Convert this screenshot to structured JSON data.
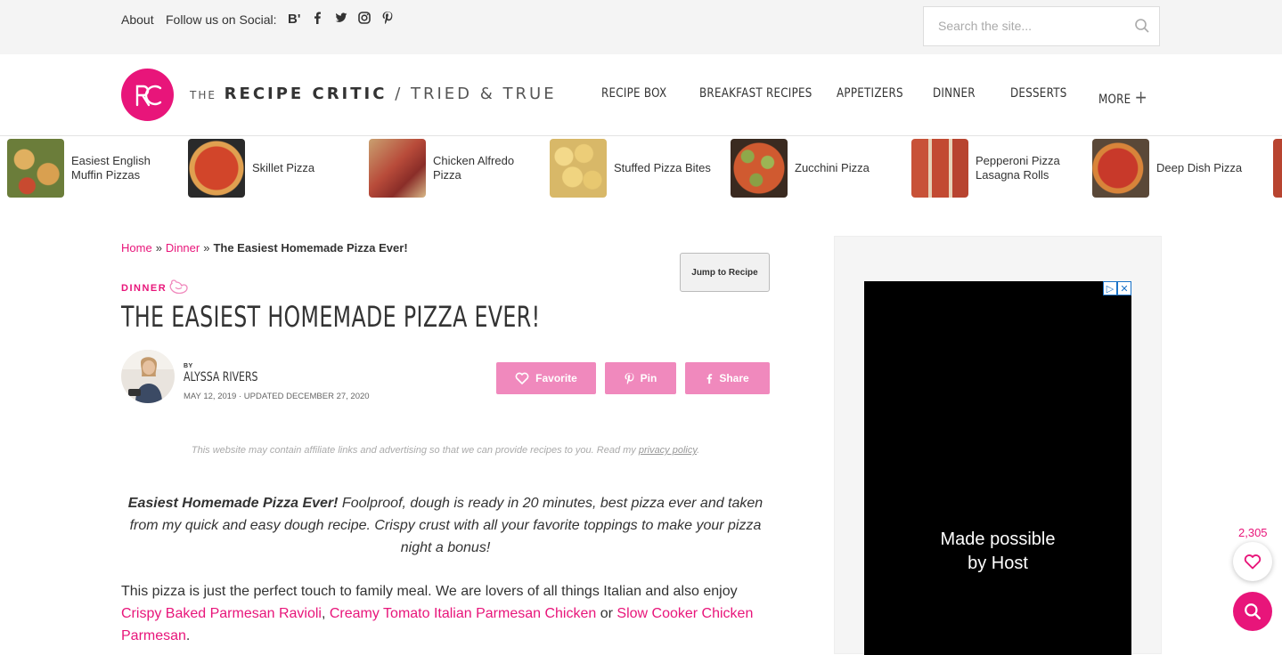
{
  "topbar": {
    "about": "About",
    "follow": "Follow us on Social:",
    "social_icons": [
      "bloglovin-icon",
      "facebook-icon",
      "twitter-icon",
      "instagram-icon",
      "pinterest-icon"
    ],
    "bloglovin_glyph": "B'",
    "search_placeholder": "Search the site..."
  },
  "header": {
    "logo_the": "THE",
    "logo_name": "RECIPE CRITIC",
    "logo_divider": "/",
    "logo_tagline": "TRIED & TRUE",
    "nav": [
      "RECIPE BOX",
      "BREAKFAST RECIPES",
      "APPETIZERS",
      "DINNER",
      "DESSERTS",
      "MORE"
    ],
    "more_glyph": "+"
  },
  "carousel": [
    "Easiest English Muffin Pizzas",
    "Skillet Pizza",
    "Chicken Alfredo Pizza",
    "Stuffed Pizza Bites",
    "Zucchini Pizza",
    "Pepperoni Pizza Lasagna Rolls",
    "Deep Dish Pizza"
  ],
  "breadcrumb": {
    "home": "Home",
    "dinner": "Dinner",
    "sep": "»",
    "current": "The Easiest Homemade Pizza Ever!"
  },
  "jump_label": "Jump to Recipe",
  "category": "DINNER",
  "title": "THE EASIEST HOMEMADE PIZZA EVER!",
  "author": {
    "by": "BY",
    "name": "ALYSSA RIVERS",
    "dates": "MAY 12, 2019 · UPDATED DECEMBER 27, 2020"
  },
  "actions": {
    "favorite": "Favorite",
    "pin": "Pin",
    "share": "Share"
  },
  "disclaimer": {
    "text": "This website may contain affiliate links and advertising so that we can provide recipes to you. Read my ",
    "link": "privacy policy",
    "end": "."
  },
  "intro": {
    "bold": "Easiest Homemade Pizza Ever!",
    "rest": " Foolproof, dough is ready in 20 minutes, best pizza ever and taken from my quick and easy dough recipe. Crispy crust with all your favorite toppings to make your pizza night a bonus!"
  },
  "body": {
    "text": "This pizza is just the perfect touch to family meal. We are lovers of all things Italian and also enjoy ",
    "link1": "Crispy Baked Parmesan Ravioli",
    "comma": ", ",
    "link2": "Creamy Tomato Italian Parmesan Chicken",
    "or": " or ",
    "link3": "Slow Cooker Chicken Parmesan",
    "end": "."
  },
  "ad": {
    "line1": "Made possible",
    "line2": "by Host"
  },
  "floating": {
    "favorites_count": "2,305"
  },
  "colors": {
    "accent": "#e8157a",
    "button_pink": "#f089bd",
    "topbar_bg": "#f4f4f4"
  }
}
